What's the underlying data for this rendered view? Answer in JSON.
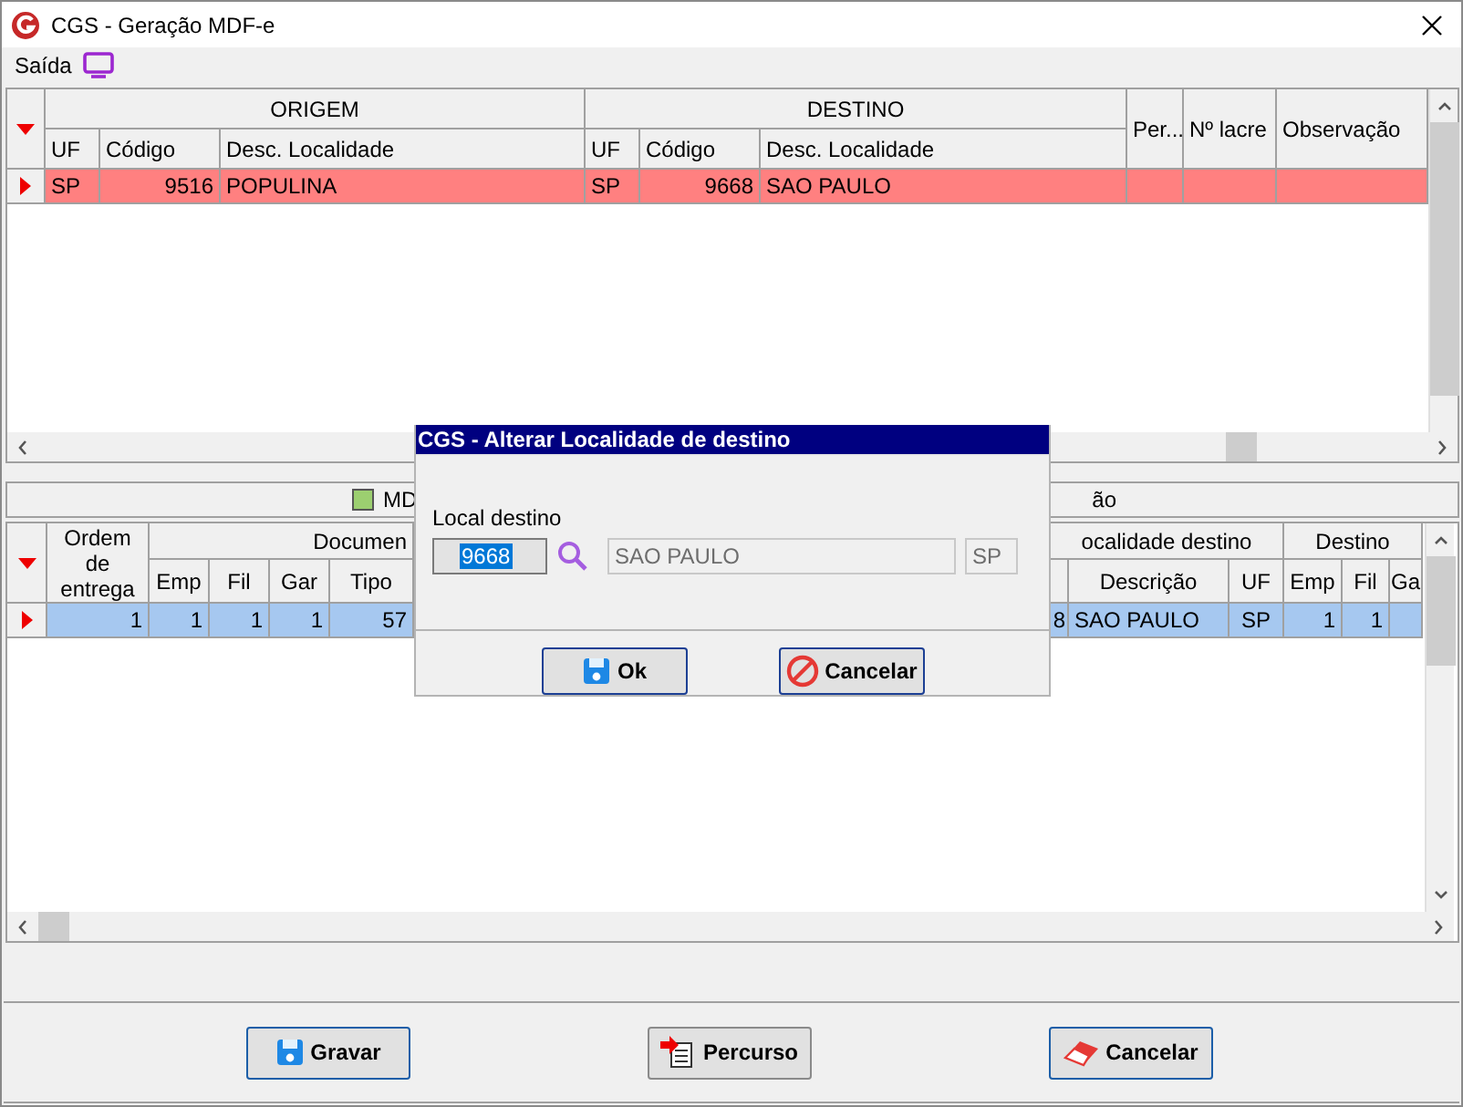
{
  "window": {
    "title": "CGS - Geração MDF-e"
  },
  "menu": [
    {
      "label": "Saída"
    }
  ],
  "routes_grid": {
    "groups": [
      "ORIGEM",
      "DESTINO"
    ],
    "columns": [
      "UF",
      "Código",
      "Desc. Localidade",
      "UF",
      "Código",
      "Desc. Localidade"
    ],
    "extra_columns": [
      "Per...",
      "Nº lacre",
      "Observação"
    ],
    "rows": [
      {
        "selected": true,
        "cells": [
          "SP",
          "9516",
          "POPULINA",
          "SP",
          "9668",
          "SAO PAULO"
        ]
      }
    ]
  },
  "legend": [
    {
      "label": "MD",
      "color": "#9ccf70"
    },
    {
      "label": "ão"
    }
  ],
  "documents_grid": {
    "groups": [
      "Documen",
      "ocalidade destino",
      "Destino"
    ],
    "columns": [
      "Ordem de entrega",
      "Emp",
      "Fil",
      "Gar",
      "Tipo",
      "",
      "Descrição",
      "UF",
      "Emp",
      "Fil",
      "Ga"
    ],
    "rows": [
      {
        "selected": true,
        "cells": [
          "1",
          "1",
          "1",
          "1",
          "57",
          "8",
          "SAO PAULO",
          "SP",
          "1",
          "1"
        ]
      }
    ]
  },
  "dialog": {
    "title": "CGS - Alterar Localidade de destino",
    "field_label": "Local destino",
    "code": "9668",
    "description": "SAO PAULO",
    "uf": "SP",
    "buttons": [
      {
        "label": "Ok",
        "kind": "save"
      },
      {
        "label": "Cancelar",
        "kind": "cancel"
      }
    ]
  },
  "buttons": [
    {
      "label": "Gravar",
      "kind": "save"
    },
    {
      "label": "Percurso",
      "kind": "route"
    },
    {
      "label": "Cancelar",
      "kind": "erase"
    }
  ]
}
